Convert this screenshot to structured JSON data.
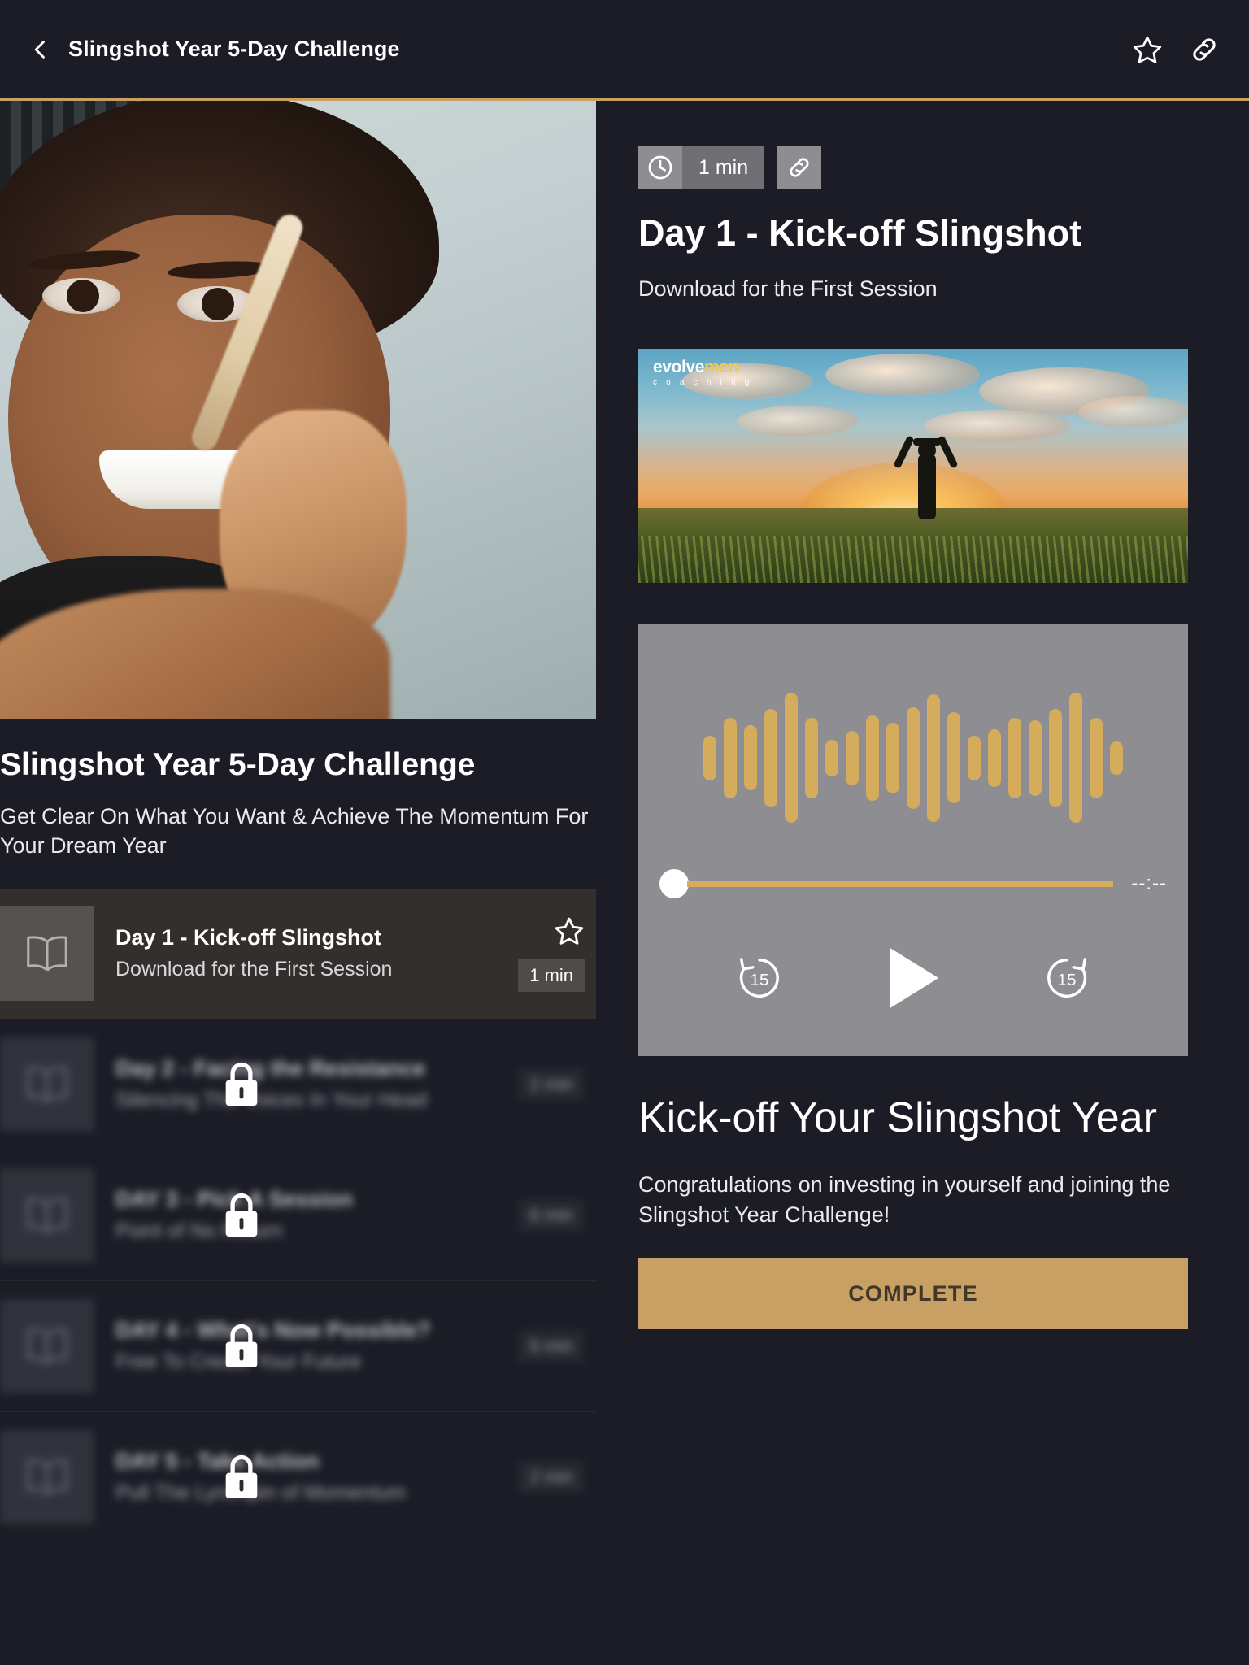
{
  "header": {
    "title": "Slingshot Year 5-Day Challenge",
    "back_icon": "chevron-left-icon",
    "favorite_icon": "star-outline-icon",
    "share_icon": "link-icon"
  },
  "course": {
    "title": "Slingshot Year 5-Day Challenge",
    "subtitle": "Get Clear On What You Want & Achieve The Momentum For Your Dream Year",
    "hero_alt": "smiling-man-with-drumstick"
  },
  "lessons": [
    {
      "title": "Day 1 - Kick-off Slingshot",
      "subtitle": "Download for the First Session",
      "duration": "1 min",
      "locked": false,
      "active": true,
      "icon": "book-icon",
      "favorite_icon": "star-outline-icon"
    },
    {
      "title": "Day 2 - Facing the Resistance",
      "subtitle": "Silencing The Voices In Your Head",
      "duration": "2 min",
      "locked": true,
      "active": false,
      "icon": "book-icon",
      "lock_icon": "lock-icon"
    },
    {
      "title": "DAY 3 - Pick A Session",
      "subtitle": "Point of No Return",
      "duration": "6 min",
      "locked": true,
      "active": false,
      "icon": "book-icon",
      "lock_icon": "lock-icon"
    },
    {
      "title": "DAY 4 - What's Now Possible?",
      "subtitle": "Free To Create Your Future",
      "duration": "6 min",
      "locked": true,
      "active": false,
      "icon": "book-icon",
      "lock_icon": "lock-icon"
    },
    {
      "title": "DAY 5 - Take Action",
      "subtitle": "Pull The Lynchpin of Momentum",
      "duration": "2 min",
      "locked": true,
      "active": false,
      "icon": "book-icon",
      "lock_icon": "lock-icon"
    }
  ],
  "detail": {
    "duration": "1 min",
    "clock_icon": "clock-icon",
    "share_icon": "link-icon",
    "title": "Day 1 - Kick-off Slingshot",
    "description": "Download for the First Session",
    "thumbnail": {
      "logo_primary": "evolve",
      "logo_accent": "men",
      "logo_sub": "c o a c h i n g",
      "alt": "man-raising-arms-at-sunrise-in-field"
    },
    "player": {
      "current_time": "--:--",
      "rewind_label": "15",
      "forward_label": "15",
      "rewind_icon": "rewind-15-icon",
      "play_icon": "play-icon",
      "forward_icon": "forward-15-icon",
      "progress_percent": 0,
      "waveform": [
        34,
        62,
        50,
        76,
        100,
        62,
        28,
        42,
        66,
        54,
        78,
        98,
        70,
        34,
        44,
        62,
        58,
        76,
        100,
        62,
        26
      ]
    },
    "heading": "Kick-off Your Slingshot Year",
    "body": "Congratulations on investing in yourself and joining the Slingshot Year Challenge!",
    "complete_label": "COMPLETE"
  },
  "colors": {
    "background": "#1b1c26",
    "accent_gold": "#c9a063",
    "waveform": "#d4ac5c",
    "player_bg": "#8e8e92",
    "active_row": "#332f2d"
  }
}
